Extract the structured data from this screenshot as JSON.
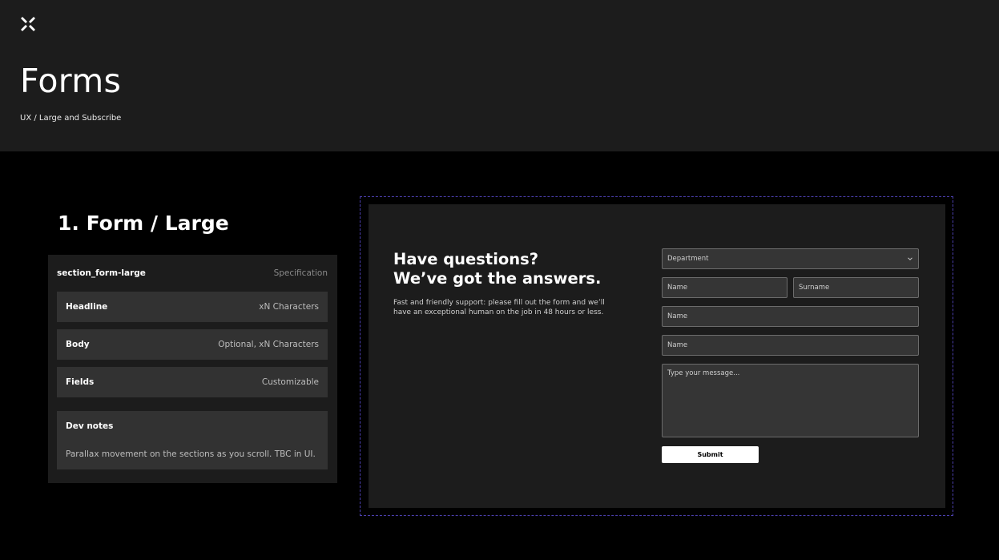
{
  "header": {
    "logo_icon": "x-cross-logo-icon",
    "title": "Forms",
    "breadcrumb": "UX / Large and Subscribe"
  },
  "section": {
    "title": "1. Form / Large"
  },
  "spec": {
    "name": "section_form-large",
    "label": "Specification",
    "rows": [
      {
        "key": "Headline",
        "value": "xN Characters"
      },
      {
        "key": "Body",
        "value": "Optional, xN Characters"
      },
      {
        "key": "Fields",
        "value": "Customizable"
      }
    ],
    "dev_notes": {
      "key": "Dev notes",
      "value": "Parallax movement on the sections as you scroll. TBC in UI."
    }
  },
  "form": {
    "headline_line1": "Have questions?",
    "headline_line2": "We’ve got the answers.",
    "body": "Fast and friendly support: please fill out the form and we’ll have an exceptional human on the job in 48 hours or less.",
    "department": "Department",
    "first_name": "Name",
    "surname": "Surname",
    "field3": "Name",
    "field4": "Name",
    "message_placeholder": "Type your message...",
    "submit_label": "Submit"
  },
  "colors": {
    "background": "#000000",
    "panel": "#1c1c1c",
    "row": "#323232",
    "frame_border": "#4b3fae",
    "button": "#ffffff"
  }
}
